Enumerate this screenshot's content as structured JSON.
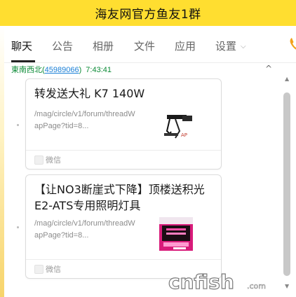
{
  "window": {
    "title": "海友网官方鱼友1群"
  },
  "tabs": [
    {
      "label": "聊天",
      "active": true
    },
    {
      "label": "公告"
    },
    {
      "label": "相册"
    },
    {
      "label": "文件"
    },
    {
      "label": "应用"
    },
    {
      "label": "设置",
      "has_dropdown": true
    }
  ],
  "message": {
    "sender_name": "東南西北",
    "sender_id_open": "(",
    "sender_id": "45989066",
    "sender_id_close": ")",
    "time": "7:43:41",
    "collapse_glyph": "^"
  },
  "cards": [
    {
      "title": "转发送大礼 K7 140W",
      "url": "/mag/circle/v1/forum/threadWapPage?tid=8...",
      "source": "微信",
      "thumb_icon": "lamp-fixture-thumbnail"
    },
    {
      "title": "【让NO3断崖式下降】顶楼送积光E2-ATS专用照明灯具",
      "url": "/mag/circle/v1/forum/threadWapPage?tid=8...",
      "source": "微信",
      "thumb_icon": "pink-aquarium-light-thumbnail"
    }
  ],
  "watermark": {
    "text": "cnfish",
    "suffix": ".com"
  },
  "colors": {
    "title_bar": "#ffde30",
    "sender": "#0a8a35",
    "link": "#1a7fd6"
  }
}
